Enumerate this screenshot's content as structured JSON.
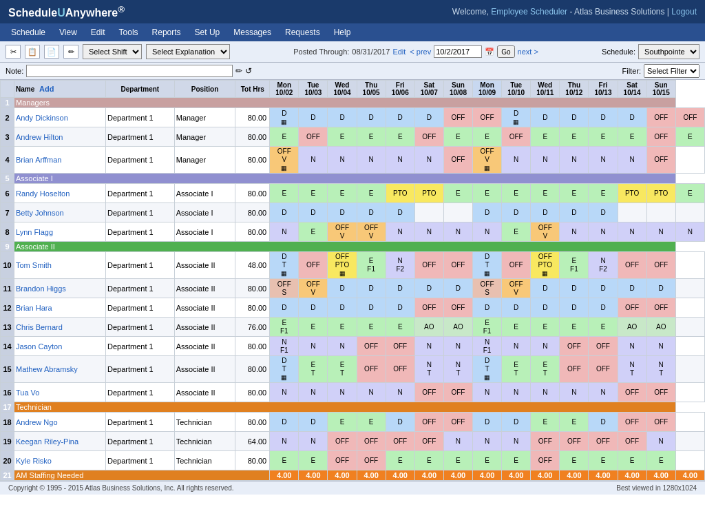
{
  "header": {
    "logo": "Schedule Anywhere",
    "logo_circle": "®",
    "welcome": "Welcome,",
    "employee_scheduler": "Employee Scheduler",
    "company": "- Atlas Business Solutions |",
    "logout": "Logout"
  },
  "navbar": {
    "items": [
      "Schedule",
      "View",
      "Edit",
      "Tools",
      "Reports",
      "Set Up",
      "Messages",
      "Requests",
      "Help"
    ]
  },
  "toolbar": {
    "shift_select_placeholder": "Select Shift",
    "explanation_select_placeholder": "Select Explanation",
    "posted_through_label": "Posted Through:",
    "posted_through_date": "08/31/2017",
    "edit_label": "Edit",
    "schedule_label": "Schedule:",
    "schedule_value": "Southpointe",
    "filter_label": "Filter:",
    "filter_placeholder": "Select Filter",
    "prev_label": "< prev",
    "next_label": "next >",
    "date_value": "10/2/2017",
    "go_label": "Go",
    "note_label": "Note:"
  },
  "table": {
    "headers": [
      "Name",
      "Department",
      "Position",
      "Tot Hrs",
      "Mon\n10/02",
      "Tue\n10/03",
      "Wed\n10/04",
      "Thu\n10/05",
      "Fri\n10/06",
      "Sat\n10/07",
      "Sun\n10/08",
      "Mon\n10/09",
      "Tue\n10/10",
      "Wed\n10/11",
      "Thu\n10/12",
      "Fri\n10/13",
      "Sat\n10/14",
      "Sun\n10/15"
    ],
    "add_label": "Add",
    "groups": [
      {
        "id": 1,
        "label": "Managers",
        "class": "group-managers",
        "employees": [
          {
            "row": 2,
            "name": "Andy Dickinson",
            "dept": "Department 1",
            "pos": "Manager",
            "hrs": "80.00",
            "shifts": [
              "D\n▦",
              "D",
              "D",
              "D",
              "D",
              "D",
              "OFF",
              "OFF",
              "D\n▦",
              "D",
              "D",
              "D",
              "D",
              "OFF",
              "OFF"
            ]
          },
          {
            "row": 3,
            "name": "Andrew Hilton",
            "dept": "Department 1",
            "pos": "Manager",
            "hrs": "80.00",
            "shifts": [
              "E",
              "OFF",
              "E",
              "E",
              "E",
              "OFF",
              "E",
              "E",
              "OFF",
              "E",
              "E",
              "E",
              "E",
              "OFF",
              "E"
            ]
          },
          {
            "row": 4,
            "name": "Brian Arffman",
            "dept": "Department 1",
            "pos": "Manager",
            "hrs": "80.00",
            "shifts": [
              "OFF\nV\n▦",
              "N",
              "N",
              "N",
              "N",
              "N",
              "OFF",
              "OFF\nV\n▦",
              "N",
              "N",
              "N",
              "N",
              "N",
              "OFF"
            ]
          }
        ]
      },
      {
        "id": 5,
        "label": "Associate I",
        "class": "group-associate1",
        "employees": [
          {
            "row": 6,
            "name": "Randy Hoselton",
            "dept": "Department 1",
            "pos": "Associate I",
            "hrs": "80.00",
            "shifts": [
              "E",
              "E",
              "E",
              "E",
              "PTO",
              "PTO",
              "E",
              "E",
              "E",
              "E",
              "E",
              "E",
              "PTO",
              "PTO",
              "E"
            ]
          },
          {
            "row": 7,
            "name": "Betty Johnson",
            "dept": "Department 1",
            "pos": "Associate I",
            "hrs": "80.00",
            "shifts": [
              "D",
              "D",
              "D",
              "D",
              "D",
              "",
              "",
              "D",
              "D",
              "D",
              "D",
              "D",
              "",
              "",
              ""
            ]
          },
          {
            "row": 8,
            "name": "Lynn Flagg",
            "dept": "Department 1",
            "pos": "Associate I",
            "hrs": "80.00",
            "shifts": [
              "N",
              "E",
              "OFF\nV",
              "OFF\nV",
              "N",
              "N",
              "N",
              "N",
              "E",
              "OFF\nV",
              "N",
              "N",
              "N",
              "N",
              "N"
            ]
          }
        ]
      },
      {
        "id": 9,
        "label": "Associate II",
        "class": "group-associate2",
        "employees": [
          {
            "row": 10,
            "name": "Tom Smith",
            "dept": "Department 1",
            "pos": "Associate II",
            "hrs": "48.00",
            "shifts": [
              "D\nT\n▦",
              "OFF",
              "OFF\nPTO\n▦",
              "E\nF1",
              "N\nF2",
              "OFF",
              "OFF",
              "D\nT\n▦",
              "OFF",
              "OFF\nPTO\n▦",
              "E\nF1",
              "N\nF2",
              "OFF",
              "OFF",
              ""
            ]
          },
          {
            "row": 11,
            "name": "Brandon Higgs",
            "dept": "Department 1",
            "pos": "Associate II",
            "hrs": "80.00",
            "shifts": [
              "OFF\nS",
              "OFF\nV",
              "D",
              "D",
              "D",
              "D",
              "D",
              "OFF\nS",
              "OFF\nV",
              "D",
              "D",
              "D",
              "D",
              "D",
              ""
            ]
          },
          {
            "row": 12,
            "name": "Brian Hara",
            "dept": "Department 1",
            "pos": "Associate II",
            "hrs": "80.00",
            "shifts": [
              "D",
              "D",
              "D",
              "D",
              "D",
              "OFF",
              "OFF",
              "D",
              "D",
              "D",
              "D",
              "D",
              "OFF",
              "OFF",
              ""
            ]
          },
          {
            "row": 13,
            "name": "Chris Bernard",
            "dept": "Department 1",
            "pos": "Associate II",
            "hrs": "76.00",
            "shifts": [
              "E\nF1",
              "E",
              "E",
              "E",
              "E",
              "AO",
              "AO",
              "E\nF1",
              "E",
              "E",
              "E",
              "E",
              "AO",
              "AO",
              ""
            ]
          },
          {
            "row": 14,
            "name": "Jason Cayton",
            "dept": "Department 1",
            "pos": "Associate II",
            "hrs": "80.00",
            "shifts": [
              "N\nF1",
              "N",
              "N",
              "OFF",
              "OFF",
              "N",
              "N",
              "N\nF1",
              "N",
              "N",
              "OFF",
              "OFF",
              "N",
              "N",
              ""
            ]
          },
          {
            "row": 15,
            "name": "Mathew Abramsky",
            "dept": "Department 1",
            "pos": "Associate II",
            "hrs": "80.00",
            "shifts": [
              "D\nT\n▦",
              "E\nT",
              "E\nT",
              "OFF",
              "OFF",
              "N\nT",
              "N\nT",
              "D\nT\n▦",
              "E\nT",
              "E\nT",
              "OFF",
              "OFF",
              "N\nT",
              "N\nT",
              ""
            ]
          },
          {
            "row": 16,
            "name": "Tua Vo",
            "dept": "Department 1",
            "pos": "Associate II",
            "hrs": "80.00",
            "shifts": [
              "N",
              "N",
              "N",
              "N",
              "N",
              "OFF",
              "OFF",
              "N",
              "N",
              "N",
              "N",
              "N",
              "OFF",
              "OFF",
              ""
            ]
          }
        ]
      },
      {
        "id": 17,
        "label": "Technician",
        "class": "group-technician",
        "employees": [
          {
            "row": 18,
            "name": "Andrew Ngo",
            "dept": "Department 1",
            "pos": "Technician",
            "hrs": "80.00",
            "shifts": [
              "D",
              "D",
              "E",
              "E",
              "D",
              "OFF",
              "OFF",
              "D",
              "D",
              "E",
              "E",
              "D",
              "OFF",
              "OFF",
              ""
            ]
          },
          {
            "row": 19,
            "name": "Keegan Riley-Pina",
            "dept": "Department 1",
            "pos": "Technician",
            "hrs": "64.00",
            "shifts": [
              "N",
              "N",
              "OFF",
              "OFF",
              "OFF",
              "OFF",
              "N",
              "N",
              "N",
              "OFF",
              "OFF",
              "OFF",
              "OFF",
              "N",
              ""
            ]
          },
          {
            "row": 20,
            "name": "Kyle Risko",
            "dept": "Department 1",
            "pos": "Technician",
            "hrs": "80.00",
            "shifts": [
              "E",
              "E",
              "OFF",
              "OFF",
              "E",
              "E",
              "E",
              "E",
              "E",
              "OFF",
              "E",
              "E",
              "E",
              "E",
              ""
            ]
          }
        ]
      }
    ],
    "am_staffing": {
      "row": 21,
      "label": "AM Staffing Needed",
      "values": [
        "4.00",
        "4.00",
        "4.00",
        "4.00",
        "4.00",
        "4.00",
        "4.00",
        "4.00",
        "4.00",
        "4.00",
        "4.00",
        "4.00",
        "4.00",
        "4.00",
        "4.00"
      ]
    }
  },
  "footer": {
    "copyright": "Copyright © 1995 - 2015 Atlas Business Solutions, Inc. All rights reserved.",
    "best_viewed": "Best viewed in 1280x1024"
  }
}
